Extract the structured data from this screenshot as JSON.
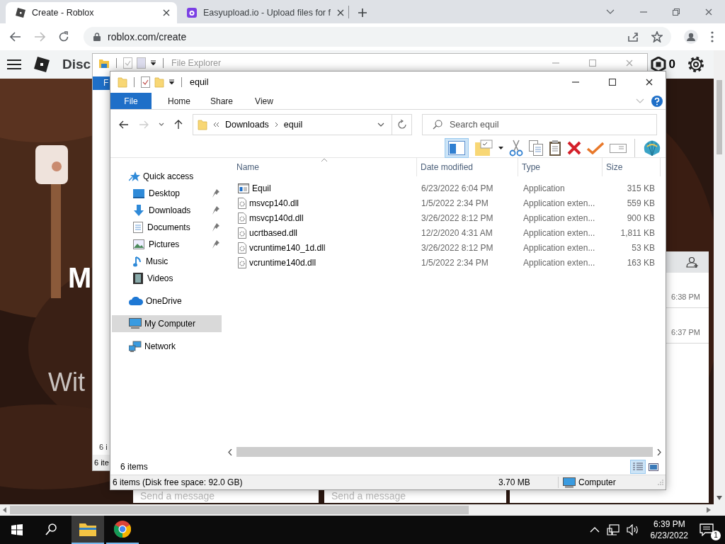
{
  "browser": {
    "tabs": [
      {
        "title": "Create - Roblox",
        "kind": "roblox",
        "selected": true
      },
      {
        "title": "Easyupload.io - Upload files for f",
        "kind": "upload",
        "selected": false
      }
    ],
    "url": "roblox.com/create",
    "page": {
      "site_title": "Disc",
      "robux_count": "0",
      "hero_heading": "M",
      "hero_subtitle": "Wit",
      "chat_times": [
        "6:38 PM",
        "6:37 PM"
      ],
      "chat_boxes": [
        {
          "placeholder": "Send a message"
        },
        {
          "placeholder": "Send a message"
        }
      ]
    }
  },
  "back_window": {
    "title": "File Explorer",
    "file_tab": "F",
    "item_count": "6 i",
    "status": "6 ite"
  },
  "explorer": {
    "title": "equil",
    "ribbon_tabs": [
      {
        "label": "File",
        "selected": true
      },
      {
        "label": "Home",
        "selected": false
      },
      {
        "label": "Share",
        "selected": false
      },
      {
        "label": "View",
        "selected": false
      }
    ],
    "breadcrumb": [
      "Downloads",
      "equil"
    ],
    "search_placeholder": "Search equil",
    "columns": [
      "Name",
      "Date modified",
      "Type",
      "Size"
    ],
    "files": [
      {
        "name": "Equil",
        "date": "6/23/2022 6:04 PM",
        "type": "Application",
        "size": "315 KB",
        "kind": "app"
      },
      {
        "name": "msvcp140.dll",
        "date": "1/5/2022 2:34 PM",
        "type": "Application exten...",
        "size": "559 KB",
        "kind": "dll"
      },
      {
        "name": "msvcp140d.dll",
        "date": "3/26/2022 8:12 PM",
        "type": "Application exten...",
        "size": "900 KB",
        "kind": "dll"
      },
      {
        "name": "ucrtbased.dll",
        "date": "12/2/2020 4:31 AM",
        "type": "Application exten...",
        "size": "1,811 KB",
        "kind": "dll"
      },
      {
        "name": "vcruntime140_1d.dll",
        "date": "3/26/2022 8:12 PM",
        "type": "Application exten...",
        "size": "53 KB",
        "kind": "dll"
      },
      {
        "name": "vcruntime140d.dll",
        "date": "1/5/2022 2:34 PM",
        "type": "Application exten...",
        "size": "163 KB",
        "kind": "dll"
      }
    ],
    "nav": [
      {
        "label": "Quick access",
        "kind": "star",
        "selected": false,
        "children": [
          {
            "label": "Desktop",
            "kind": "desktop",
            "pinned": true,
            "selected": false
          },
          {
            "label": "Downloads",
            "kind": "download",
            "pinned": true,
            "selected": false
          },
          {
            "label": "Documents",
            "kind": "document",
            "pinned": true,
            "selected": false
          },
          {
            "label": "Pictures",
            "kind": "pictures",
            "pinned": true,
            "selected": false
          },
          {
            "label": "Music",
            "kind": "music",
            "pinned": false,
            "selected": false
          },
          {
            "label": "Videos",
            "kind": "videos",
            "pinned": false,
            "selected": false
          }
        ]
      },
      {
        "label": "OneDrive",
        "kind": "cloud",
        "selected": false
      },
      {
        "label": "My Computer",
        "kind": "computer",
        "selected": true
      },
      {
        "label": "Network",
        "kind": "network",
        "selected": false
      }
    ],
    "item_count": "6 items",
    "status": {
      "summary": "6 items (Disk free space: 92.0 GB)",
      "size": "3.70 MB",
      "location": "Computer"
    }
  },
  "taskbar": {
    "apps": [
      {
        "kind": "explorer",
        "selected": true
      },
      {
        "kind": "chrome",
        "selected": false
      }
    ],
    "time": "6:39 PM",
    "date": "6/23/2022",
    "notification_count": "1"
  }
}
